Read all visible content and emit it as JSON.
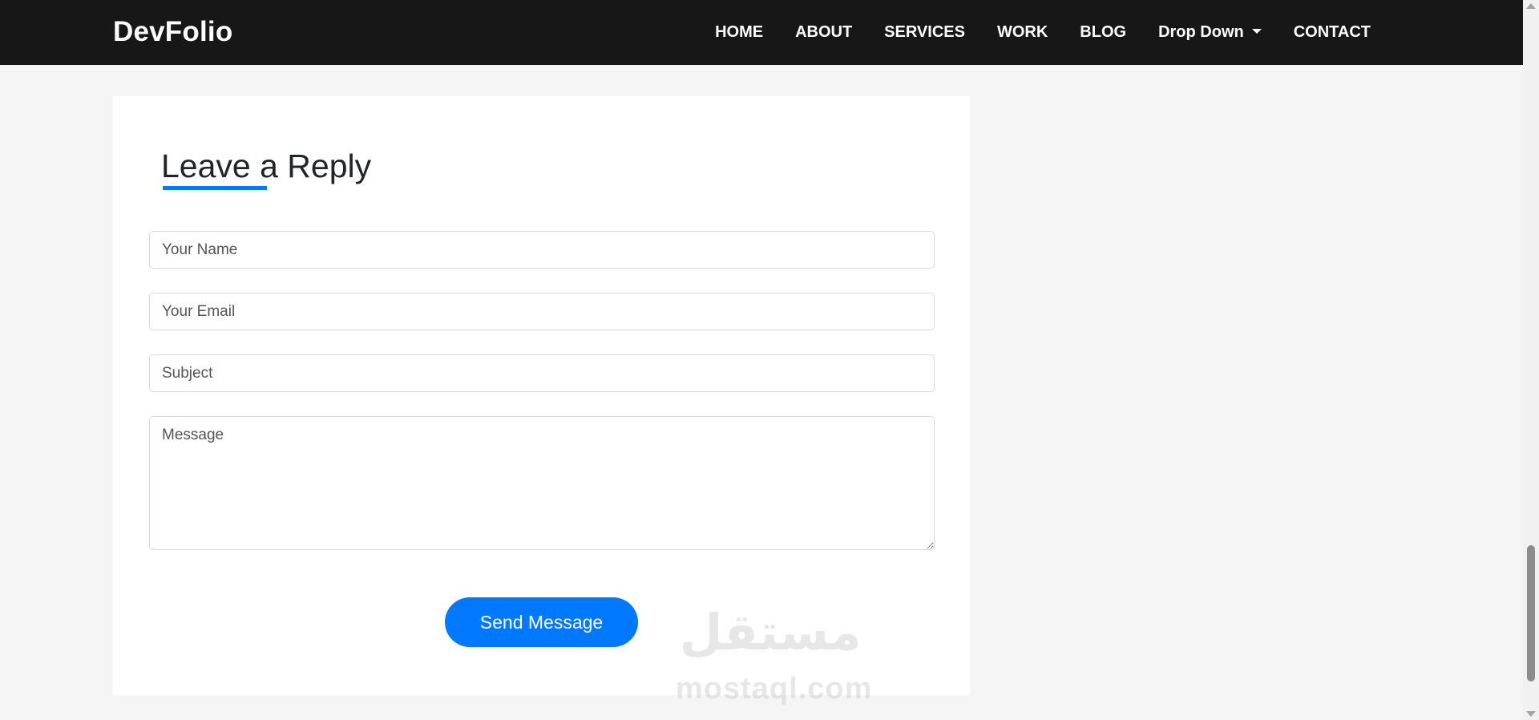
{
  "navbar": {
    "brand": "DevFolio",
    "items": [
      {
        "label": "HOME"
      },
      {
        "label": "ABOUT"
      },
      {
        "label": "SERVICES"
      },
      {
        "label": "WORK"
      },
      {
        "label": "BLOG"
      },
      {
        "label": "Drop Down",
        "has_caret": true
      },
      {
        "label": "CONTACT"
      }
    ]
  },
  "reply_form": {
    "title": "Leave a Reply",
    "name_placeholder": "Your Name",
    "email_placeholder": "Your Email",
    "subject_placeholder": "Subject",
    "message_placeholder": "Message",
    "submit_label": "Send Message"
  },
  "watermark": {
    "arabic": "مستقل",
    "latin": "mostaql.com"
  },
  "colors": {
    "navbar_bg": "#171717",
    "accent": "#0078ff",
    "page_bg": "#f5f5f5",
    "card_bg": "#ffffff"
  }
}
